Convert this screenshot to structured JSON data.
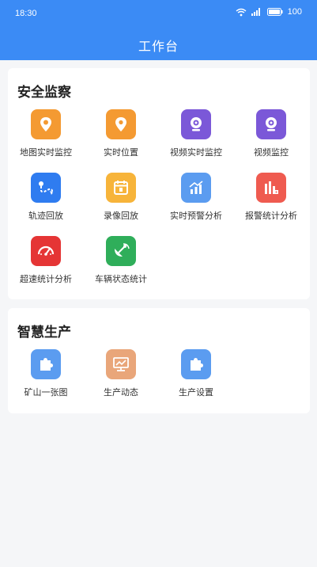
{
  "status_bar": {
    "time": "18:30",
    "battery": "100"
  },
  "header": {
    "title": "工作台"
  },
  "sections": [
    {
      "title": "安全监察",
      "items": [
        {
          "label": "地图实时监控",
          "icon": "map-pin-icon",
          "color": "#f49a32"
        },
        {
          "label": "实时位置",
          "icon": "location-icon",
          "color": "#f49a32"
        },
        {
          "label": "视频实时监控",
          "icon": "webcam-icon",
          "color": "#7b58d8"
        },
        {
          "label": "视频监控",
          "icon": "webcam-icon",
          "color": "#7b58d8"
        },
        {
          "label": "轨迹回放",
          "icon": "track-icon",
          "color": "#2f7cf0"
        },
        {
          "label": "录像回放",
          "icon": "calendar-icon",
          "color": "#f7b43a"
        },
        {
          "label": "实时预警分析",
          "icon": "trend-chart-icon",
          "color": "#5b9cf0"
        },
        {
          "label": "报警统计分析",
          "icon": "alarm-bar-icon",
          "color": "#ef5b50"
        },
        {
          "label": "超速统计分析",
          "icon": "speedometer-icon",
          "color": "#e53535"
        },
        {
          "label": "车辆状态统计",
          "icon": "satellite-icon",
          "color": "#2fae5a"
        }
      ]
    },
    {
      "title": "智慧生产",
      "items": [
        {
          "label": "矿山一张图",
          "icon": "puzzle-icon",
          "color": "#5b9cf0"
        },
        {
          "label": "生产动态",
          "icon": "monitor-icon",
          "color": "#e9a67a"
        },
        {
          "label": "生产设置",
          "icon": "puzzle-icon",
          "color": "#5b9cf0"
        }
      ]
    }
  ]
}
